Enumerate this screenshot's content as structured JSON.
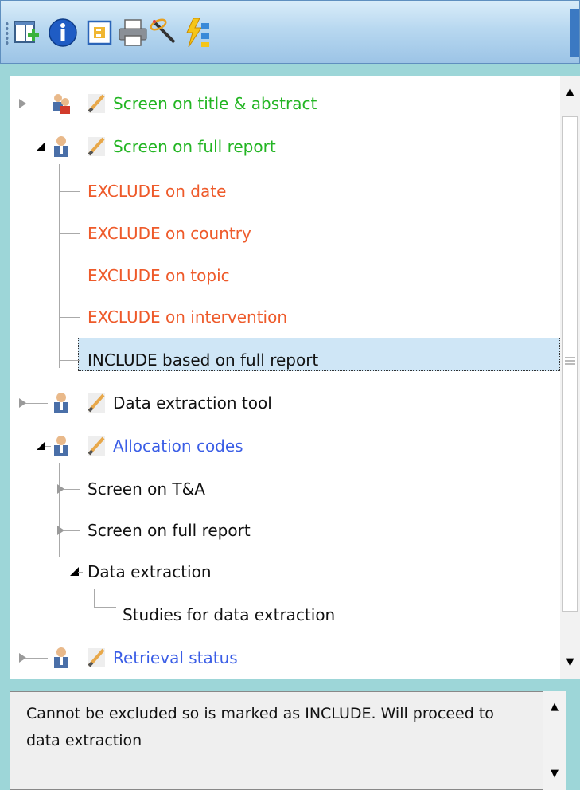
{
  "toolbar": {
    "buttons": [
      {
        "icon": "add-window-icon"
      },
      {
        "icon": "info-icon"
      },
      {
        "icon": "properties-icon"
      },
      {
        "icon": "print-icon"
      },
      {
        "icon": "wand-icon"
      },
      {
        "icon": "lightning-hierarchy-icon"
      }
    ]
  },
  "tree": {
    "nodes": [
      {
        "label": "Screen on title & abstract"
      },
      {
        "label": "Screen on full report"
      },
      {
        "label": "EXCLUDE on date"
      },
      {
        "label": "EXCLUDE on country"
      },
      {
        "label": "EXCLUDE on topic"
      },
      {
        "label": "EXCLUDE on intervention"
      },
      {
        "label": "INCLUDE based on full report"
      },
      {
        "label": "Data extraction tool"
      },
      {
        "label": "Allocation codes"
      },
      {
        "label": "Screen on T&A"
      },
      {
        "label": "Screen on full report"
      },
      {
        "label": "Data extraction"
      },
      {
        "label": "Studies for data extraction"
      },
      {
        "label": "Retrieval status"
      }
    ],
    "colors": {
      "green": "#23b523",
      "red": "#ee5a2a",
      "blue": "#3b5ee6",
      "selected": "#cfe6f6"
    }
  },
  "info": {
    "text": "Cannot be excluded so is marked as INCLUDE. Will proceed to data extraction"
  }
}
